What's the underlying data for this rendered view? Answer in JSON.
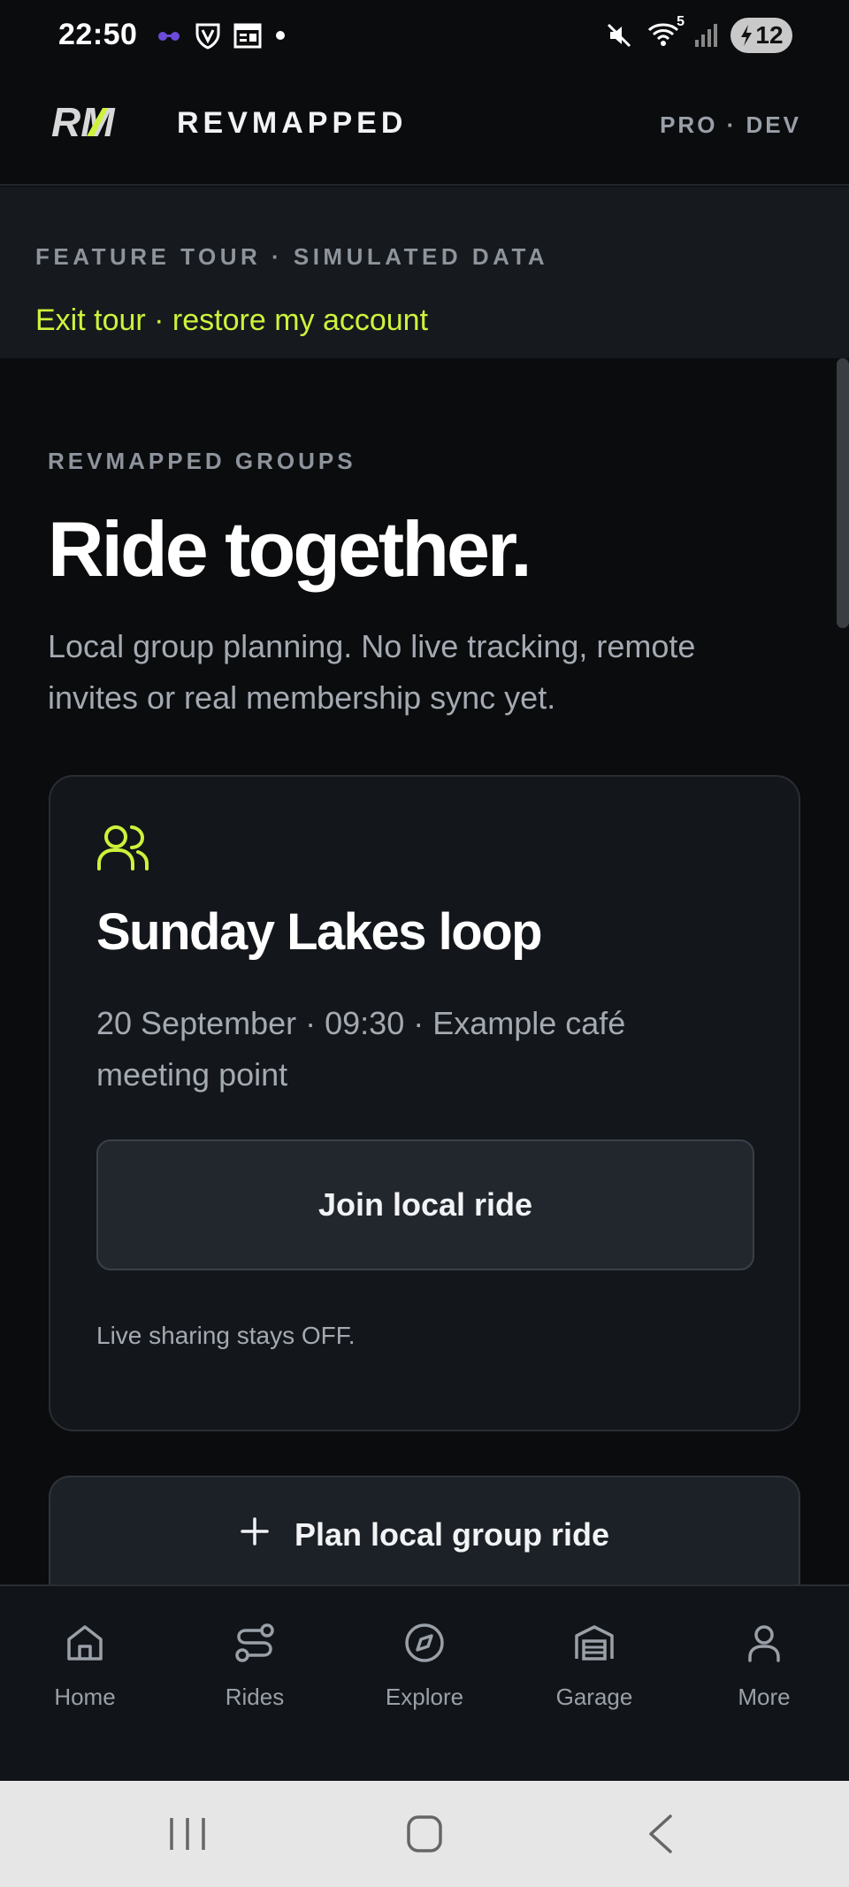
{
  "status_bar": {
    "time": "22:50",
    "battery_level": "12",
    "signal_label": "5"
  },
  "header": {
    "logo_text": "RM",
    "brand": "REVMAPPED",
    "plan_badge": "PRO · DEV",
    "accent_color": "#cdf23c"
  },
  "tour_banner": {
    "eyebrow": "FEATURE TOUR · SIMULATED DATA",
    "exit_link": "Exit tour · restore my account"
  },
  "main": {
    "eyebrow": "REVMAPPED GROUPS",
    "title": "Ride together.",
    "subtitle": "Local group planning. No live tracking, remote invites or real membership sync yet.",
    "ride_card": {
      "icon": "users-icon",
      "title": "Sunday Lakes loop",
      "meta": "20 September · 09:30 · Example café meeting point",
      "join_label": "Join local ride",
      "note": "Live sharing stays OFF."
    },
    "plan_button_label": "Plan local group ride"
  },
  "bottom_nav": {
    "items": [
      {
        "label": "Home",
        "icon": "home-icon"
      },
      {
        "label": "Rides",
        "icon": "route-icon"
      },
      {
        "label": "Explore",
        "icon": "compass-icon"
      },
      {
        "label": "Garage",
        "icon": "garage-icon"
      },
      {
        "label": "More",
        "icon": "person-icon"
      }
    ]
  },
  "system_nav": {
    "items": [
      "recents-button",
      "home-button",
      "back-button"
    ]
  }
}
